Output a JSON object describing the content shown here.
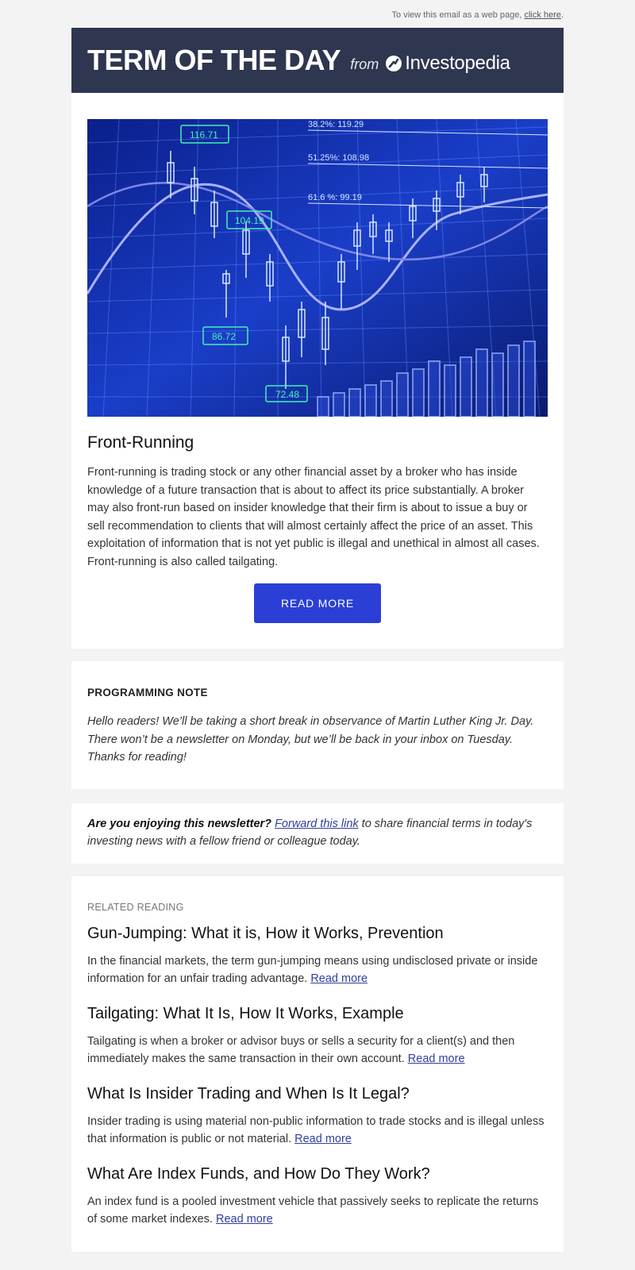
{
  "top_note": {
    "text": "To view this email as a web page,",
    "link": "click here",
    "end": "."
  },
  "header": {
    "title": "TERM OF THE DAY",
    "from": "from",
    "brand": "Investopedia",
    "bg_color": "#2f3650"
  },
  "hero": {
    "icon": "stock-chart-image",
    "labels": [
      "116.71",
      "104.19",
      "86.72",
      "72.48",
      "38.2%: 119.29",
      "51.25%: 108.98",
      "61.6 %: 99.19"
    ]
  },
  "term": {
    "title": "Front-Running",
    "body": "Front-running is trading stock or any other financial asset by a broker who has inside knowledge of a future transaction that is about to affect its price substantially. A broker may also front-run based on insider knowledge that their firm is about to issue a buy or sell recommendation to clients that will almost certainly affect the price of an asset. This exploitation of information that is not yet public is illegal and unethical in almost all cases. Front-running is also called tailgating.",
    "button": "READ MORE",
    "button_color": "#2b3fd6"
  },
  "note": {
    "label": "PROGRAMMING NOTE",
    "body": "Hello readers! We’ll be taking a short break in observance of Martin Luther King Jr. Day. There won’t be a newsletter on Monday, but we’ll be back in your inbox on Tuesday. Thanks for reading!"
  },
  "share": {
    "question": "Are you enjoying this newsletter?",
    "link": "Forward this link",
    "rest": "to share financial terms in today's investing news with a fellow friend or colleague today."
  },
  "related": {
    "label": "RELATED READING",
    "read_more": "Read more",
    "articles": [
      {
        "title": "Gun-Jumping: What it is, How it Works, Prevention",
        "summary": "In the financial markets, the term gun-jumping means using undisclosed private or inside information for an unfair trading advantage."
      },
      {
        "title": "Tailgating: What It Is, How It Works, Example",
        "summary": "Tailgating is when a broker or advisor buys or sells a security for a client(s) and then immediately makes the same transaction in their own account."
      },
      {
        "title": "What Is Insider Trading and When Is It Legal?",
        "summary": "Insider trading is using material non-public information to trade stocks and is illegal unless that information is public or not material."
      },
      {
        "title": "What Are Index Funds, and How Do They Work?",
        "summary": "An index fund is a pooled investment vehicle that passively seeks to replicate the returns of some market indexes."
      }
    ]
  }
}
